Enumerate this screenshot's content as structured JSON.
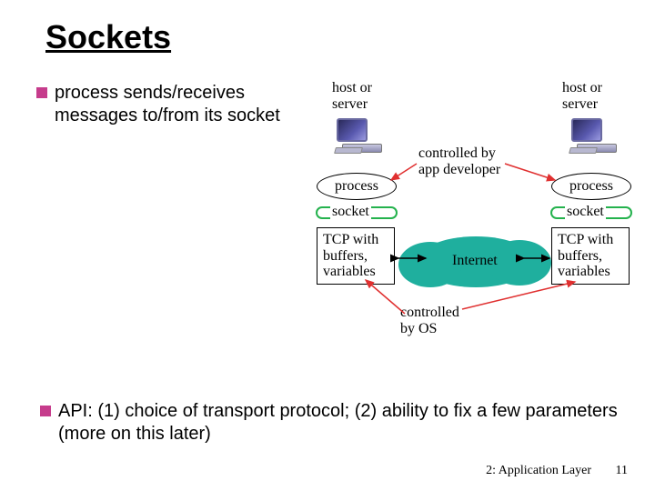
{
  "title": "Sockets",
  "bullets": {
    "b1": "process sends/receives messages to/from its socket",
    "b2": "API: (1) choice of transport protocol; (2) ability to fix a few parameters (more on  this later)"
  },
  "labels": {
    "host_left": "host or\nserver",
    "host_right": "host or\nserver",
    "process_left": "process",
    "process_right": "process",
    "socket_left": "socket",
    "socket_right": "socket",
    "tcp_left": "TCP with\nbuffers,\nvariables",
    "tcp_right": "TCP with\nbuffers,\nvariables",
    "internet": "Internet",
    "controlled_app": "controlled by\napp developer",
    "controlled_os": "controlled\nby OS"
  },
  "footer": {
    "chapter": "2: Application Layer",
    "page": "11"
  },
  "colors": {
    "bullet": "#c63c8c",
    "socket_outline": "#24b24d",
    "cloud": "#1faf9e",
    "arrow_red": "#e03030"
  }
}
